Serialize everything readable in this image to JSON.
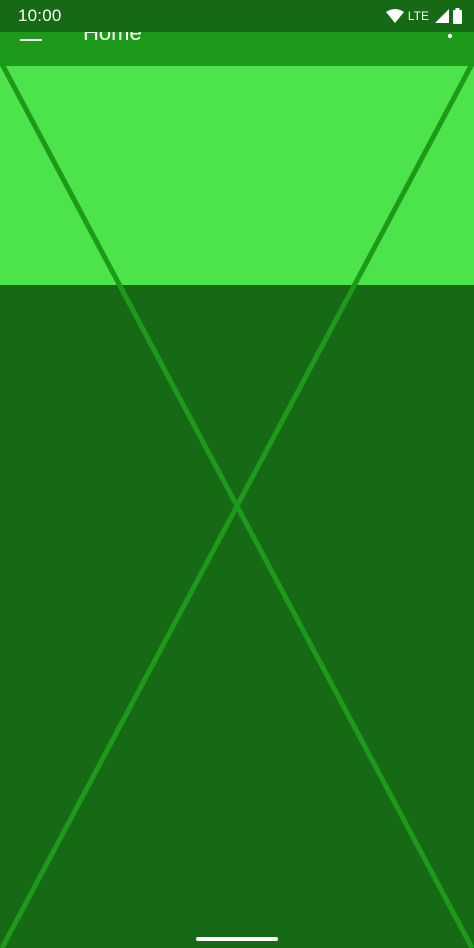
{
  "status_bar": {
    "time": "10:00",
    "network": "LTE",
    "icons": [
      "wifi-icon",
      "cellular-signal-icon",
      "battery-icon"
    ]
  },
  "app_bar": {
    "title": "Home",
    "icons": [
      "menu-icon",
      "overflow-menu-icon"
    ]
  },
  "colors": {
    "status_bar": "#166915",
    "app_bar": "#1e9a1b",
    "header_panel": "#4de34a",
    "content_background": "#166915",
    "placeholder_lines": "#1e9a1b",
    "foreground": "#ffffff"
  }
}
